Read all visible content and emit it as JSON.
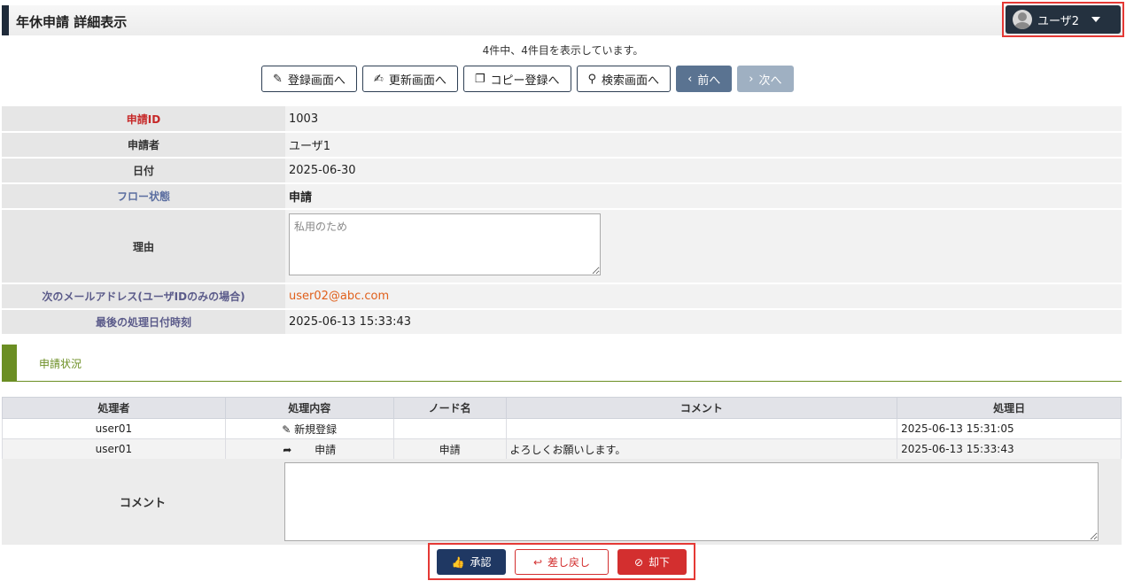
{
  "header": {
    "title": "年休申請 詳細表示",
    "user_name": "ユーザ2"
  },
  "record_info": "4件中、4件目を表示しています。",
  "toolbar": {
    "register": "登録画面へ",
    "update": "更新画面へ",
    "copy": "コピー登録へ",
    "search": "検索画面へ",
    "prev": "前へ",
    "next": "次へ"
  },
  "detail": {
    "id_label": "申請ID",
    "id_value": "1003",
    "applicant_label": "申請者",
    "applicant_value": "ユーザ1",
    "date_label": "日付",
    "date_value": "2025-06-30",
    "flow_label": "フロー状態",
    "flow_value": "申請",
    "reason_label": "理由",
    "reason_value": "私用のため",
    "mail_label": "次のメールアドレス(ユーザIDのみの場合)",
    "mail_value": "user02@abc.com",
    "last_label": "最後の処理日付時刻",
    "last_value": "2025-06-13 15:33:43"
  },
  "section": {
    "title": "申請状況"
  },
  "history": {
    "headers": [
      "処理者",
      "処理内容",
      "ノード名",
      "コメント",
      "処理日"
    ],
    "rows": [
      {
        "processor": "user01",
        "icon": "pencil-icon",
        "action": "新規登録",
        "node": "",
        "comment": "",
        "date": "2025-06-13 15:31:05"
      },
      {
        "processor": "user01",
        "icon": "share-arrow-icon",
        "action": "申請",
        "node": "申請",
        "comment": "よろしくお願いします。",
        "date": "2025-06-13 15:33:43"
      }
    ]
  },
  "comment": {
    "label": "コメント",
    "value": ""
  },
  "actions": {
    "approve": "承認",
    "sendback": "差し戻し",
    "reject": "却下"
  },
  "colors": {
    "header_dark": "#24313f",
    "approve": "#1f3863",
    "reject": "#d32f2f",
    "section_green": "#6b8e23",
    "highlight_border": "#e53935"
  }
}
